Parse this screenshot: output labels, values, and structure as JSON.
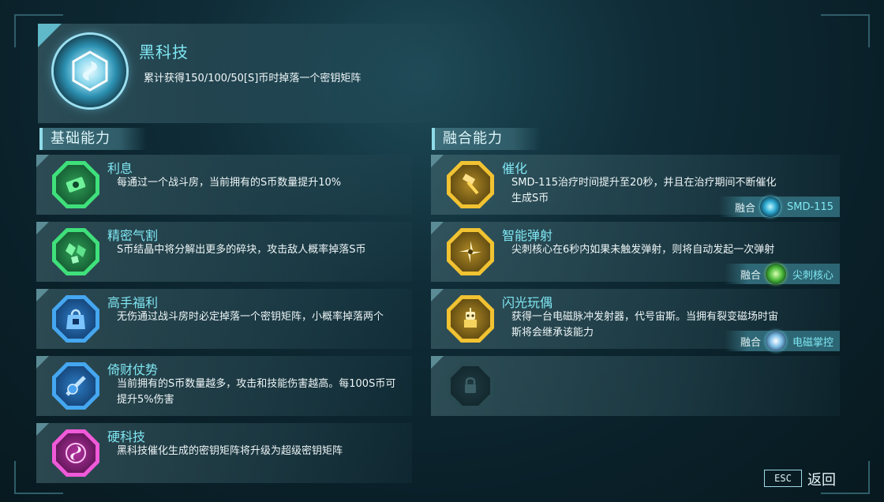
{
  "header": {
    "title": "黑科技",
    "description": "累计获得150/100/50[S]币时掉落一个密钥矩阵",
    "icon": "vortex-cube-icon"
  },
  "sections": {
    "basic_title": "基础能力",
    "fusion_title": "融合能力"
  },
  "basic_abilities": [
    {
      "name": "利息",
      "desc": "每通过一个战斗房，当前拥有的S币数量提升10%",
      "icon": "money-bundle-icon",
      "color": "#3fe07b"
    },
    {
      "name": "精密气割",
      "desc": "S币结晶中将分解出更多的碎块，攻击敌人概率掉落S币",
      "icon": "crystal-shard-icon",
      "color": "#3fe07b"
    },
    {
      "name": "高手福利",
      "desc": "无伤通过战斗房时必定掉落一个密钥矩阵，小概率掉落两个",
      "icon": "gift-bag-icon",
      "color": "#45a7f0"
    },
    {
      "name": "倚财仗势",
      "desc": "当前拥有的S币数量越多，攻击和技能伤害越高。每100S币可提升5%伤害",
      "icon": "coin-sword-icon",
      "color": "#45a7f0"
    },
    {
      "name": "硬科技",
      "desc": "黑科技催化生成的密钥矩阵将升级为超级密钥矩阵",
      "icon": "pink-vortex-icon",
      "color": "#f05ad8"
    }
  ],
  "fusion_abilities": [
    {
      "name": "催化",
      "desc": "SMD-115治疗时间提升至20秒，并且在治疗期间不断催化生成S币",
      "icon": "catalyst-tool-icon",
      "fusion_label": "融合",
      "fusion_name": "SMD-115"
    },
    {
      "name": "智能弹射",
      "desc": "尖刺核心在6秒内如果未触发弹射，则将自动发起一次弹射",
      "icon": "spinning-blade-icon",
      "fusion_label": "融合",
      "fusion_name": "尖刺核心"
    },
    {
      "name": "闪光玩偶",
      "desc": "获得一台电磁脉冲发射器，代号宙斯。当拥有裂变磁场时宙斯将会继承该能力",
      "icon": "robot-doll-icon",
      "fusion_label": "融合",
      "fusion_name": "电磁掌控"
    }
  ],
  "locked_slot_icon": "lock-icon",
  "footer": {
    "esc_key": "ESC",
    "back_label": "返回"
  }
}
